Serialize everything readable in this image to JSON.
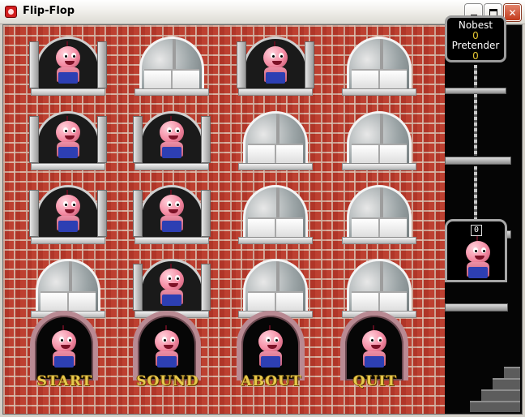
{
  "window": {
    "title": "Flip-Flop"
  },
  "colors": {
    "brick": "#b83a2c",
    "mortar": "#dcc8b9",
    "label_gold": "#e7c84b",
    "score_value": "#e4c633",
    "panel_bg": "#050505"
  },
  "score_panel": {
    "label1": "Nobest",
    "value1": "0",
    "label2": "Pretender",
    "value2": "0"
  },
  "elevator": {
    "counter": "0"
  },
  "grid": {
    "rows": [
      [
        "open",
        "closed",
        "open",
        "closed"
      ],
      [
        "open",
        "open",
        "closed",
        "closed"
      ],
      [
        "open",
        "open",
        "closed",
        "closed"
      ],
      [
        "closed",
        "open",
        "closed",
        "closed"
      ]
    ]
  },
  "menu": {
    "start": "START",
    "sound": "SOUND",
    "about": "ABOUT",
    "quit": "QUIT"
  },
  "icons": {
    "app": "flip-flop-app-icon",
    "minimize": "minimize-icon",
    "maximize": "maximize-icon",
    "close": "close-icon"
  }
}
